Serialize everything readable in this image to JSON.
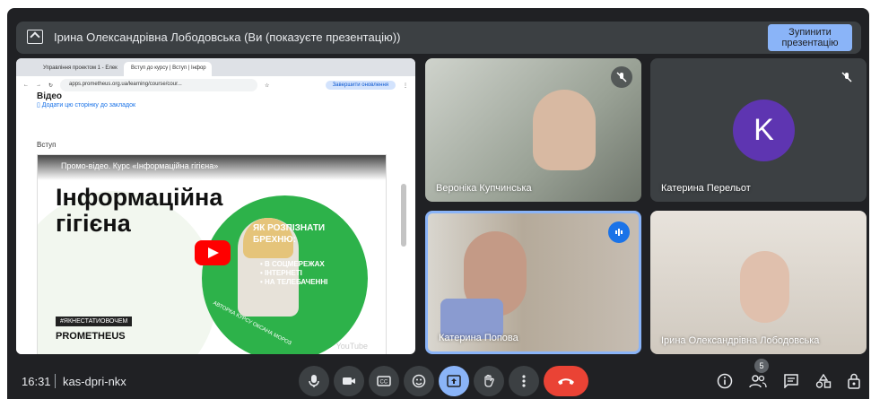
{
  "banner": {
    "title": "Ірина Олександрівна Лободовська (Ви (показуєте презентацію))",
    "stop_label": "Зупинити презентацію"
  },
  "browser": {
    "tabs": [
      "Управління проектом 1 - Елек",
      "Вступ до курсу | Вступ | Інфор"
    ],
    "url": "apps.prometheus.org.ua/learning/course/cour...",
    "update_label": "Завершити оновлення",
    "partial_heading": "Відео",
    "bookmark_label": "Додати цю сторінку до закладок",
    "section_label": "Вступ",
    "video": {
      "top_title": "Промо-відео. Курс «Інформаційна гігієна»",
      "title_line1": "Інформаційна",
      "title_line2": "гігієна",
      "question": "ЯК РОЗПІЗНАТИ\nБРЕХНЮ:",
      "bullets": "• В СОЦМЕРЕЖАХ\n• ІНТЕРНЕТІ\n• НА ТЕЛЕБАЧЕННІ",
      "hashtag": "#ЯКНЕСТАТИОВОЧЕМ",
      "brand": "PROMETHEUS",
      "author": "АВТОРКА КУРСУ ОКСАНА МОРОЗ",
      "yt_watermark": "YouTube"
    }
  },
  "participants": [
    {
      "name": "Вероніка Купчинська",
      "muted": true
    },
    {
      "name": "Катерина Перельот",
      "muted": true,
      "avatar_letter": "K",
      "avatar_color": "#5e35b1"
    },
    {
      "name": "Катерина Попова",
      "speaking": true
    },
    {
      "name": "Ірина Олександрівна Лободовська"
    }
  ],
  "bottom_bar": {
    "time": "16:31",
    "meeting_code": "kas-dpri-nkx",
    "participant_count": "5",
    "controls": [
      "mic-icon",
      "camera-icon",
      "captions-icon",
      "emoji-icon",
      "present-icon",
      "raise-hand-icon",
      "more-icon",
      "hangup-icon"
    ],
    "right_controls": [
      "info-icon",
      "people-icon",
      "chat-icon",
      "activities-icon",
      "host-controls-icon"
    ]
  },
  "colors": {
    "bg": "#202124",
    "accent": "#8ab4f8",
    "hangup": "#ea4335",
    "speaking": "#1a73e8"
  }
}
